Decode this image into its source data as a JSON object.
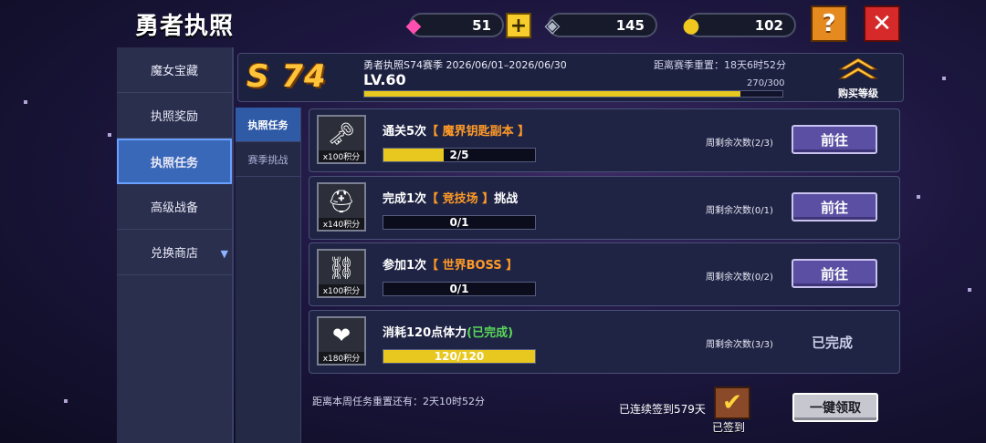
{
  "header": {
    "title": "勇者执照",
    "gems": "51",
    "crystals": "145",
    "gold": "102",
    "plus_icon": "+",
    "help_icon": "?",
    "close_icon": "✕"
  },
  "left_nav": {
    "items": [
      {
        "label": "魔女宝藏"
      },
      {
        "label": "执照奖励"
      },
      {
        "label": "执照任务"
      },
      {
        "label": "高级战备"
      },
      {
        "label": "兑换商店"
      }
    ],
    "active_index": 2
  },
  "season": {
    "badge": "S 74",
    "info": "勇者执照S74赛季  2026/06/01–2026/06/30",
    "countdown": "距离赛季重置：18天6时52分",
    "level": "LV.60",
    "exp": "270/300",
    "exp_fraction": 0.9,
    "buy_label": "购买等级"
  },
  "sub_tabs": [
    {
      "label": "执照任务"
    },
    {
      "label": "赛季挑战"
    }
  ],
  "tasks": [
    {
      "prefix": "通关5次",
      "highlight": "【 魔界钥匙副本 】",
      "suffix": "",
      "done_tag": "",
      "points": "x100积分",
      "progress": "2/5",
      "progress_fraction": 0.4,
      "remaining": "周剩余次数(2/3)",
      "action": "前往",
      "icon": "key-icon",
      "glyph": "🗝"
    },
    {
      "prefix": "完成1次",
      "highlight": "【 竞技场 】",
      "suffix": "挑战",
      "done_tag": "",
      "points": "x140积分",
      "progress": "0/1",
      "progress_fraction": 0,
      "remaining": "周剩余次数(0/1)",
      "action": "前往",
      "icon": "helmet-icon",
      "glyph": "⛑"
    },
    {
      "prefix": "参加1次",
      "highlight": "【 世界BOSS 】",
      "suffix": "",
      "done_tag": "",
      "points": "x100积分",
      "progress": "0/1",
      "progress_fraction": 0,
      "remaining": "周剩余次数(0/2)",
      "action": "前往",
      "icon": "chest-icon",
      "glyph": "⛓"
    },
    {
      "prefix": "消耗120点体力",
      "highlight": "",
      "suffix": "",
      "done_tag": "(已完成)",
      "points": "x180积分",
      "progress": "120/120",
      "progress_fraction": 1,
      "remaining": "周剩余次数(3/3)",
      "action": "已完成",
      "icon": "stamina-icon",
      "glyph": "❤"
    }
  ],
  "footer": {
    "weekly_reset": "距离本周任务重置还有：2天10时52分",
    "signin_streak": "已连续签到579天",
    "signin_label": "已签到",
    "claim_all": "一键领取"
  },
  "colors": {
    "accent": "#3968b8",
    "progress": "#e8c81e",
    "highlight": "#ff9a28",
    "done": "#59d65a",
    "close": "#d62a2a",
    "help": "#e58a1f"
  }
}
